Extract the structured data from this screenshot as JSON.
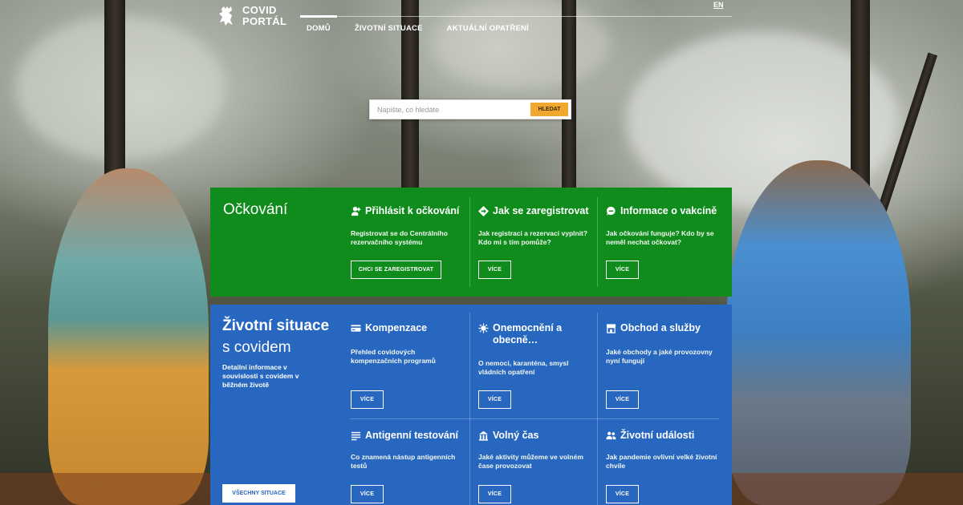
{
  "header": {
    "logo_line1": "COVID",
    "logo_line2": "PORTÁL",
    "lang": "EN",
    "nav": [
      "DOMŮ",
      "ŽIVOTNÍ SITUACE",
      "AKTUÁLNÍ OPATŘENÍ"
    ]
  },
  "search": {
    "placeholder": "Napište, co hledáte",
    "button": "HLEDAT"
  },
  "vaccination": {
    "title": "Očkování",
    "columns": [
      {
        "title": "Přihlásit k očkování",
        "icon": "user-plus-icon",
        "desc": "Registrovat se do Centrálního rezervačního systému",
        "button": "CHCI SE ZAREGISTROVAT"
      },
      {
        "title": "Jak se zaregistrovat",
        "icon": "diamond-arrow-icon",
        "desc": "Jak registraci a rezervaci vyplnit? Kdo mi s tím pomůže?",
        "button": "VÍCE"
      },
      {
        "title": "Informace o vakcíně",
        "icon": "chat-icon",
        "desc": "Jak očkování funguje? Kdo by se neměl nechat očkovat?",
        "button": "VÍCE"
      }
    ]
  },
  "life": {
    "title_bold": "Životní situace",
    "title_light": "s covidem",
    "desc": "Detailní informace v souvislosti s covidem v běžném životě",
    "all_button": "VŠECHNY SITUACE",
    "items": [
      {
        "title": "Kompenzace",
        "icon": "card-icon",
        "desc": "Přehled covidových kompenzačních programů",
        "button": "VÍCE"
      },
      {
        "title": "Onemocnění a obecně…",
        "icon": "virus-icon",
        "desc": "O nemoci, karanténa, smysl vládních opatření",
        "button": "VÍCE"
      },
      {
        "title": "Obchod a služby",
        "icon": "shop-icon",
        "desc": "Jaké obchody a jaké provozovny nyní fungují",
        "button": "VÍCE"
      },
      {
        "title": "Antigenní testování",
        "icon": "list-icon",
        "desc": "Co znamená nástup antigenních testů",
        "button": "VÍCE"
      },
      {
        "title": "Volný čas",
        "icon": "building-icon",
        "desc": "Jaké aktivity můžeme ve volném čase provozovat",
        "button": "VÍCE"
      },
      {
        "title": "Životní události",
        "icon": "people-icon",
        "desc": "Jak pandemie ovlivní velké životní chvíle",
        "button": "VÍCE"
      }
    ]
  }
}
